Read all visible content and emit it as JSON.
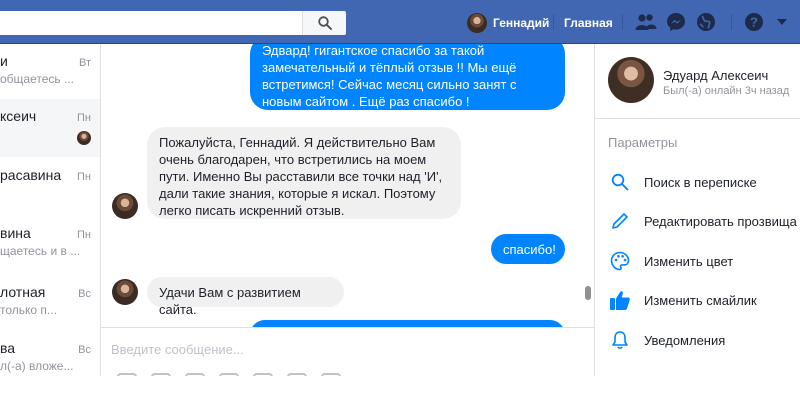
{
  "topbar": {
    "user_name": "Геннадий",
    "home_label": "Главная",
    "icons": [
      "search-icon",
      "friends-icon",
      "messenger-icon",
      "globe-icon",
      "help-icon",
      "dropdown-arrow-icon"
    ]
  },
  "conversations": [
    {
      "name": "и",
      "snippet": "общаетесь ...",
      "day": "Вт"
    },
    {
      "name": "ксеич",
      "snippet": "",
      "day": "Пн",
      "active": true
    },
    {
      "name": "расавина",
      "snippet": "",
      "day": "Пн"
    },
    {
      "name": "вина",
      "snippet": "щаетесь и в ...",
      "day": "Пн"
    },
    {
      "name": "лотная",
      "snippet": "только п...",
      "day": "Вс"
    },
    {
      "name": "ва",
      "snippet": "л(-а) вложе...",
      "day": "Вс"
    }
  ],
  "messages": [
    {
      "direction": "out",
      "text": "Эдвард! гигантское спасибо за такой замечательный и тёплый отзыв !!  Мы ещё встретимся! Сейчас месяц сильно занят с новым сайтом . Ещё раз спасибо !"
    },
    {
      "direction": "in",
      "text": "Пожалуйста, Геннадий. Я действительно Вам очень благодарен, что встретились на моем пути. Именно Вы расставили все точки над 'И', дали такие знания, которые я искал. Поэтому легко писать искренний отзыв."
    },
    {
      "direction": "out",
      "text": "спасибо!"
    },
    {
      "direction": "in",
      "text": "Удачи Вам с развитием сайта."
    }
  ],
  "composer": {
    "placeholder": "Введите сообщение..."
  },
  "right_panel": {
    "contact_name": "Эдуард Алексеич",
    "status": "Был(-а) онлайн 3ч назад",
    "section_title": "Параметры",
    "items": [
      {
        "label": "Поиск в переписке",
        "icon": "search-icon"
      },
      {
        "label": "Редактировать прозвища",
        "icon": "pencil-icon"
      },
      {
        "label": "Изменить цвет",
        "icon": "palette-icon"
      },
      {
        "label": "Изменить смайлик",
        "icon": "thumbs-up-icon"
      },
      {
        "label": "Уведомления",
        "icon": "bell-icon"
      }
    ]
  },
  "colors": {
    "topbar": "#4267b2",
    "outgoing_bubble": "#0084ff",
    "incoming_bubble": "#f1f0f0",
    "accent_icon": "#0084ff"
  }
}
